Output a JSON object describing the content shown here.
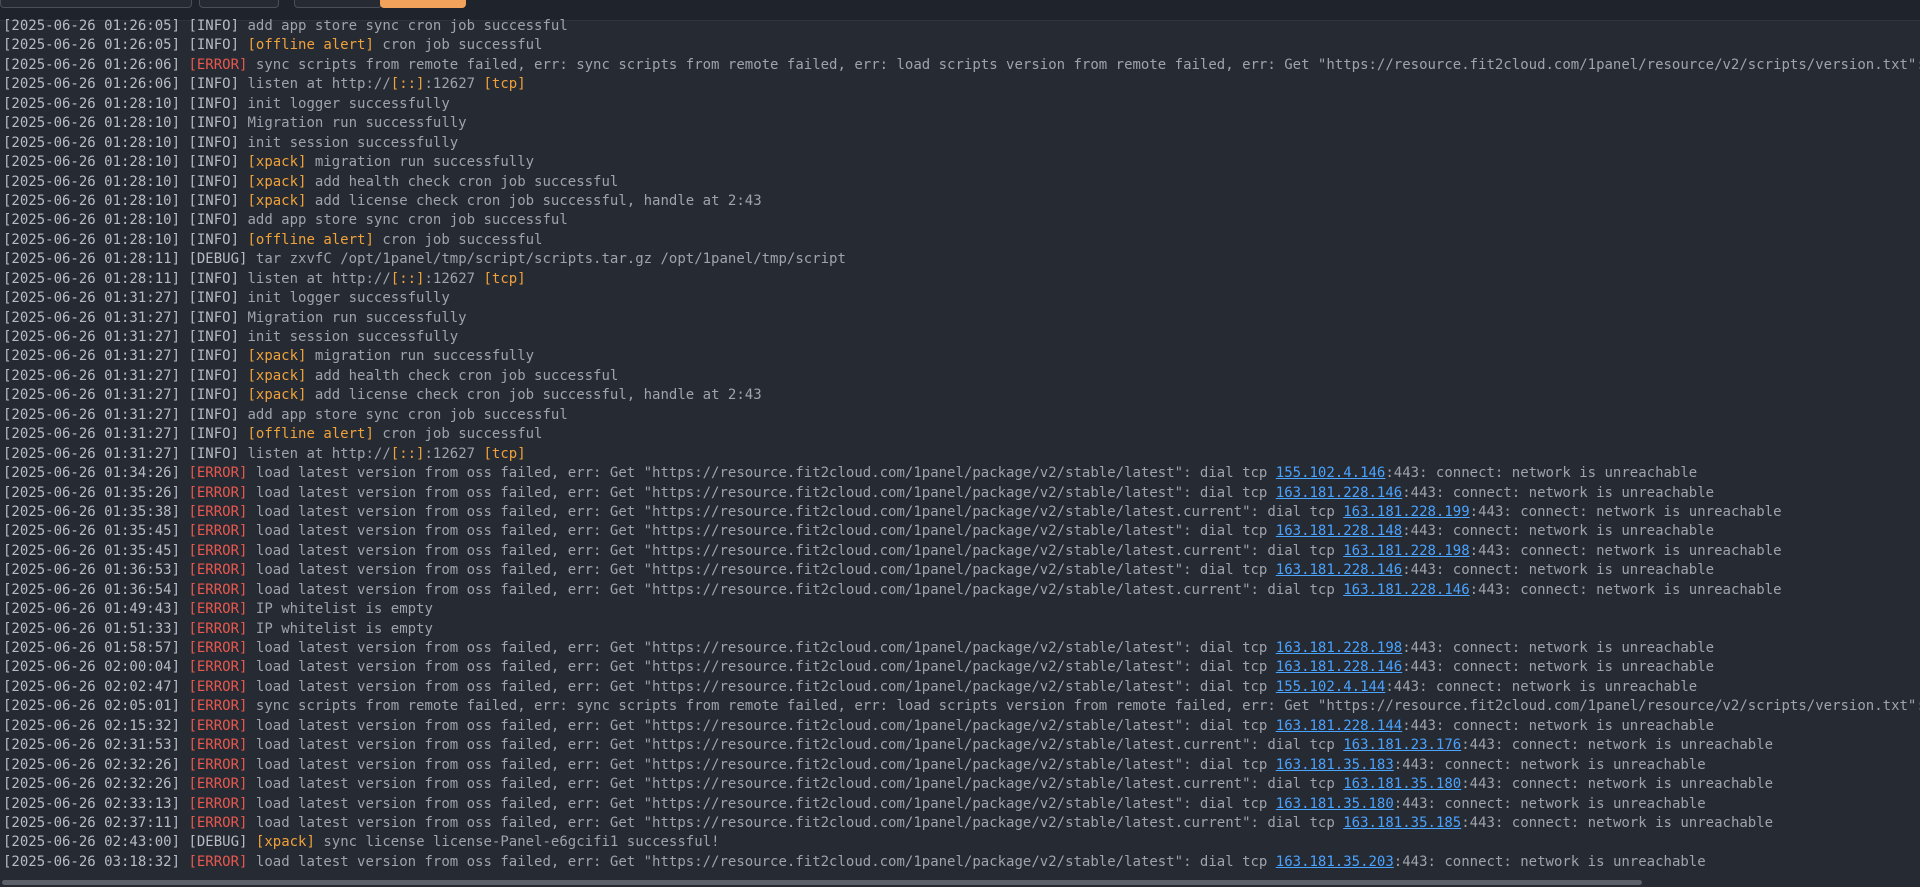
{
  "colors": {
    "background": "#262a33",
    "error": "#e8584e",
    "tag": "#f0a23a",
    "link": "#4aa3ff",
    "text": "#9fa3ab"
  },
  "log_lines": [
    {
      "ts": "[2025-06-26 01:26:05]",
      "level": "INFO",
      "parts": [
        {
          "t": "add app store sync cron job successful"
        }
      ]
    },
    {
      "ts": "[2025-06-26 01:26:05]",
      "level": "INFO",
      "parts": [
        {
          "t": "[offline alert]",
          "k": "tag"
        },
        {
          "t": " cron job successful"
        }
      ]
    },
    {
      "ts": "[2025-06-26 01:26:06]",
      "level": "ERROR",
      "parts": [
        {
          "t": "sync scripts from remote failed, err: sync scripts from remote failed, err: load scripts version from remote failed, err: Get \"https://resource.fit2cloud.com/1panel/resource/v2/scripts/version.txt\": dial t"
        }
      ]
    },
    {
      "ts": "[2025-06-26 01:26:06]",
      "level": "INFO",
      "parts": [
        {
          "t": "listen at http://"
        },
        {
          "t": "[::]",
          "k": "tag"
        },
        {
          "t": ":12627 "
        },
        {
          "t": "[tcp]",
          "k": "tag"
        }
      ]
    },
    {
      "ts": "[2025-06-26 01:28:10]",
      "level": "INFO",
      "parts": [
        {
          "t": "init logger successfully"
        }
      ]
    },
    {
      "ts": "[2025-06-26 01:28:10]",
      "level": "INFO",
      "parts": [
        {
          "t": "Migration run successfully"
        }
      ]
    },
    {
      "ts": "[2025-06-26 01:28:10]",
      "level": "INFO",
      "parts": [
        {
          "t": "init session successfully"
        }
      ]
    },
    {
      "ts": "[2025-06-26 01:28:10]",
      "level": "INFO",
      "parts": [
        {
          "t": "[xpack]",
          "k": "tag"
        },
        {
          "t": " migration run successfully"
        }
      ]
    },
    {
      "ts": "[2025-06-26 01:28:10]",
      "level": "INFO",
      "parts": [
        {
          "t": "[xpack]",
          "k": "tag"
        },
        {
          "t": " add health check cron job successful"
        }
      ]
    },
    {
      "ts": "[2025-06-26 01:28:10]",
      "level": "INFO",
      "parts": [
        {
          "t": "[xpack]",
          "k": "tag"
        },
        {
          "t": " add license check cron job successful, handle at 2:43"
        }
      ]
    },
    {
      "ts": "[2025-06-26 01:28:10]",
      "level": "INFO",
      "parts": [
        {
          "t": "add app store sync cron job successful"
        }
      ]
    },
    {
      "ts": "[2025-06-26 01:28:10]",
      "level": "INFO",
      "parts": [
        {
          "t": "[offline alert]",
          "k": "tag"
        },
        {
          "t": " cron job successful"
        }
      ]
    },
    {
      "ts": "[2025-06-26 01:28:11]",
      "level": "DEBUG",
      "parts": [
        {
          "t": "tar zxvfC /opt/1panel/tmp/script/scripts.tar.gz /opt/1panel/tmp/script"
        }
      ]
    },
    {
      "ts": "[2025-06-26 01:28:11]",
      "level": "INFO",
      "parts": [
        {
          "t": "listen at http://"
        },
        {
          "t": "[::]",
          "k": "tag"
        },
        {
          "t": ":12627 "
        },
        {
          "t": "[tcp]",
          "k": "tag"
        }
      ]
    },
    {
      "ts": "[2025-06-26 01:31:27]",
      "level": "INFO",
      "parts": [
        {
          "t": "init logger successfully"
        }
      ]
    },
    {
      "ts": "[2025-06-26 01:31:27]",
      "level": "INFO",
      "parts": [
        {
          "t": "Migration run successfully"
        }
      ]
    },
    {
      "ts": "[2025-06-26 01:31:27]",
      "level": "INFO",
      "parts": [
        {
          "t": "init session successfully"
        }
      ]
    },
    {
      "ts": "[2025-06-26 01:31:27]",
      "level": "INFO",
      "parts": [
        {
          "t": "[xpack]",
          "k": "tag"
        },
        {
          "t": " migration run successfully"
        }
      ]
    },
    {
      "ts": "[2025-06-26 01:31:27]",
      "level": "INFO",
      "parts": [
        {
          "t": "[xpack]",
          "k": "tag"
        },
        {
          "t": " add health check cron job successful"
        }
      ]
    },
    {
      "ts": "[2025-06-26 01:31:27]",
      "level": "INFO",
      "parts": [
        {
          "t": "[xpack]",
          "k": "tag"
        },
        {
          "t": " add license check cron job successful, handle at 2:43"
        }
      ]
    },
    {
      "ts": "[2025-06-26 01:31:27]",
      "level": "INFO",
      "parts": [
        {
          "t": "add app store sync cron job successful"
        }
      ]
    },
    {
      "ts": "[2025-06-26 01:31:27]",
      "level": "INFO",
      "parts": [
        {
          "t": "[offline alert]",
          "k": "tag"
        },
        {
          "t": " cron job successful"
        }
      ]
    },
    {
      "ts": "[2025-06-26 01:31:27]",
      "level": "INFO",
      "parts": [
        {
          "t": "listen at http://"
        },
        {
          "t": "[::]",
          "k": "tag"
        },
        {
          "t": ":12627 "
        },
        {
          "t": "[tcp]",
          "k": "tag"
        }
      ]
    },
    {
      "ts": "[2025-06-26 01:34:26]",
      "level": "ERROR",
      "parts": [
        {
          "t": "load latest version from oss failed, err: Get \"https://resource.fit2cloud.com/1panel/package/v2/stable/latest\": dial tcp "
        },
        {
          "t": "155.102.4.146",
          "k": "link"
        },
        {
          "t": ":443: connect: network is unreachable"
        }
      ]
    },
    {
      "ts": "[2025-06-26 01:35:26]",
      "level": "ERROR",
      "parts": [
        {
          "t": "load latest version from oss failed, err: Get \"https://resource.fit2cloud.com/1panel/package/v2/stable/latest\": dial tcp "
        },
        {
          "t": "163.181.228.146",
          "k": "link"
        },
        {
          "t": ":443: connect: network is unreachable"
        }
      ]
    },
    {
      "ts": "[2025-06-26 01:35:38]",
      "level": "ERROR",
      "parts": [
        {
          "t": "load latest version from oss failed, err: Get \"https://resource.fit2cloud.com/1panel/package/v2/stable/latest.current\": dial tcp "
        },
        {
          "t": "163.181.228.199",
          "k": "link"
        },
        {
          "t": ":443: connect: network is unreachable"
        }
      ]
    },
    {
      "ts": "[2025-06-26 01:35:45]",
      "level": "ERROR",
      "parts": [
        {
          "t": "load latest version from oss failed, err: Get \"https://resource.fit2cloud.com/1panel/package/v2/stable/latest\": dial tcp "
        },
        {
          "t": "163.181.228.148",
          "k": "link"
        },
        {
          "t": ":443: connect: network is unreachable"
        }
      ]
    },
    {
      "ts": "[2025-06-26 01:35:45]",
      "level": "ERROR",
      "parts": [
        {
          "t": "load latest version from oss failed, err: Get \"https://resource.fit2cloud.com/1panel/package/v2/stable/latest.current\": dial tcp "
        },
        {
          "t": "163.181.228.198",
          "k": "link"
        },
        {
          "t": ":443: connect: network is unreachable"
        }
      ]
    },
    {
      "ts": "[2025-06-26 01:36:53]",
      "level": "ERROR",
      "parts": [
        {
          "t": "load latest version from oss failed, err: Get \"https://resource.fit2cloud.com/1panel/package/v2/stable/latest\": dial tcp "
        },
        {
          "t": "163.181.228.146",
          "k": "link"
        },
        {
          "t": ":443: connect: network is unreachable"
        }
      ]
    },
    {
      "ts": "[2025-06-26 01:36:54]",
      "level": "ERROR",
      "parts": [
        {
          "t": "load latest version from oss failed, err: Get \"https://resource.fit2cloud.com/1panel/package/v2/stable/latest.current\": dial tcp "
        },
        {
          "t": "163.181.228.146",
          "k": "link"
        },
        {
          "t": ":443: connect: network is unreachable"
        }
      ]
    },
    {
      "ts": "[2025-06-26 01:49:43]",
      "level": "ERROR",
      "parts": [
        {
          "t": "IP whitelist is empty"
        }
      ]
    },
    {
      "ts": "[2025-06-26 01:51:33]",
      "level": "ERROR",
      "parts": [
        {
          "t": "IP whitelist is empty"
        }
      ]
    },
    {
      "ts": "[2025-06-26 01:58:57]",
      "level": "ERROR",
      "parts": [
        {
          "t": "load latest version from oss failed, err: Get \"https://resource.fit2cloud.com/1panel/package/v2/stable/latest\": dial tcp "
        },
        {
          "t": "163.181.228.198",
          "k": "link"
        },
        {
          "t": ":443: connect: network is unreachable"
        }
      ]
    },
    {
      "ts": "[2025-06-26 02:00:04]",
      "level": "ERROR",
      "parts": [
        {
          "t": "load latest version from oss failed, err: Get \"https://resource.fit2cloud.com/1panel/package/v2/stable/latest\": dial tcp "
        },
        {
          "t": "163.181.228.146",
          "k": "link"
        },
        {
          "t": ":443: connect: network is unreachable"
        }
      ]
    },
    {
      "ts": "[2025-06-26 02:02:47]",
      "level": "ERROR",
      "parts": [
        {
          "t": "load latest version from oss failed, err: Get \"https://resource.fit2cloud.com/1panel/package/v2/stable/latest\": dial tcp "
        },
        {
          "t": "155.102.4.144",
          "k": "link"
        },
        {
          "t": ":443: connect: network is unreachable"
        }
      ]
    },
    {
      "ts": "[2025-06-26 02:05:01]",
      "level": "ERROR",
      "parts": [
        {
          "t": "sync scripts from remote failed, err: sync scripts from remote failed, err: load scripts version from remote failed, err: Get \"https://resource.fit2cloud.com/1panel/resource/v2/scripts/version.txt\": dial t"
        }
      ]
    },
    {
      "ts": "[2025-06-26 02:15:32]",
      "level": "ERROR",
      "parts": [
        {
          "t": "load latest version from oss failed, err: Get \"https://resource.fit2cloud.com/1panel/package/v2/stable/latest\": dial tcp "
        },
        {
          "t": "163.181.228.144",
          "k": "link"
        },
        {
          "t": ":443: connect: network is unreachable"
        }
      ]
    },
    {
      "ts": "[2025-06-26 02:31:53]",
      "level": "ERROR",
      "parts": [
        {
          "t": "load latest version from oss failed, err: Get \"https://resource.fit2cloud.com/1panel/package/v2/stable/latest.current\": dial tcp "
        },
        {
          "t": "163.181.23.176",
          "k": "link"
        },
        {
          "t": ":443: connect: network is unreachable"
        }
      ]
    },
    {
      "ts": "[2025-06-26 02:32:26]",
      "level": "ERROR",
      "parts": [
        {
          "t": "load latest version from oss failed, err: Get \"https://resource.fit2cloud.com/1panel/package/v2/stable/latest\": dial tcp "
        },
        {
          "t": "163.181.35.183",
          "k": "link"
        },
        {
          "t": ":443: connect: network is unreachable"
        }
      ]
    },
    {
      "ts": "[2025-06-26 02:32:26]",
      "level": "ERROR",
      "parts": [
        {
          "t": "load latest version from oss failed, err: Get \"https://resource.fit2cloud.com/1panel/package/v2/stable/latest.current\": dial tcp "
        },
        {
          "t": "163.181.35.180",
          "k": "link"
        },
        {
          "t": ":443: connect: network is unreachable"
        }
      ]
    },
    {
      "ts": "[2025-06-26 02:33:13]",
      "level": "ERROR",
      "parts": [
        {
          "t": "load latest version from oss failed, err: Get \"https://resource.fit2cloud.com/1panel/package/v2/stable/latest\": dial tcp "
        },
        {
          "t": "163.181.35.180",
          "k": "link"
        },
        {
          "t": ":443: connect: network is unreachable"
        }
      ]
    },
    {
      "ts": "[2025-06-26 02:37:11]",
      "level": "ERROR",
      "parts": [
        {
          "t": "load latest version from oss failed, err: Get \"https://resource.fit2cloud.com/1panel/package/v2/stable/latest.current\": dial tcp "
        },
        {
          "t": "163.181.35.185",
          "k": "link"
        },
        {
          "t": ":443: connect: network is unreachable"
        }
      ]
    },
    {
      "ts": "[2025-06-26 02:43:00]",
      "level": "DEBUG",
      "parts": [
        {
          "t": "[xpack]",
          "k": "tag"
        },
        {
          "t": " sync license license-Panel-e6gcifi1 successful!"
        }
      ]
    },
    {
      "ts": "[2025-06-26 03:18:32]",
      "level": "ERROR",
      "parts": [
        {
          "t": "load latest version from oss failed, err: Get \"https://resource.fit2cloud.com/1panel/package/v2/stable/latest\": dial tcp "
        },
        {
          "t": "163.181.35.203",
          "k": "link"
        },
        {
          "t": ":443: connect: network is unreachable"
        }
      ]
    }
  ]
}
